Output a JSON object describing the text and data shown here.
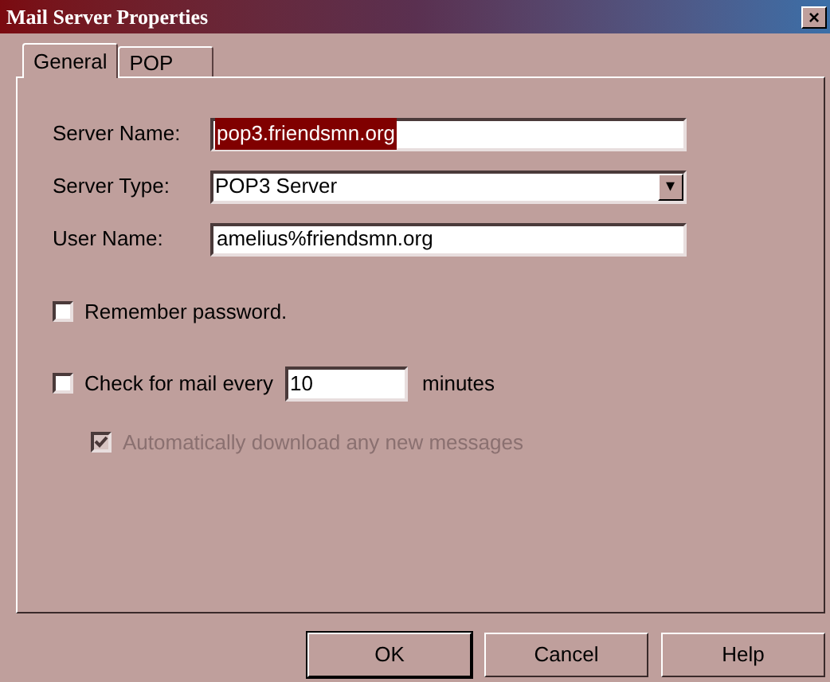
{
  "window": {
    "title": "Mail Server Properties",
    "close": "×"
  },
  "tabs": [
    {
      "label": "General",
      "selected": true
    },
    {
      "label": "POP",
      "selected": false
    }
  ],
  "fields": [
    {
      "kind": "text",
      "label": "Server Name:",
      "value": "pop3.friendsmn.org",
      "text_selected": true
    },
    {
      "kind": "dropdown",
      "label": "Server Type:",
      "value": "POP3 Server",
      "arrow": "▾"
    },
    {
      "kind": "text",
      "label": "User Name:",
      "value": "amelius%friendsmn.org",
      "text_selected": false
    }
  ],
  "remember_password": {
    "label": "Remember password.",
    "checked": false,
    "disabled": false
  },
  "check_mail": {
    "label": "Check for mail every",
    "checked": false,
    "disabled": false,
    "value": "10",
    "unit": "minutes"
  },
  "auto_download": {
    "label": "Automatically download any new messages",
    "checked": true,
    "disabled": true
  },
  "buttons": [
    {
      "label": "OK",
      "default": true
    },
    {
      "label": "Cancel",
      "default": false
    },
    {
      "label": "Help",
      "default": false
    }
  ]
}
